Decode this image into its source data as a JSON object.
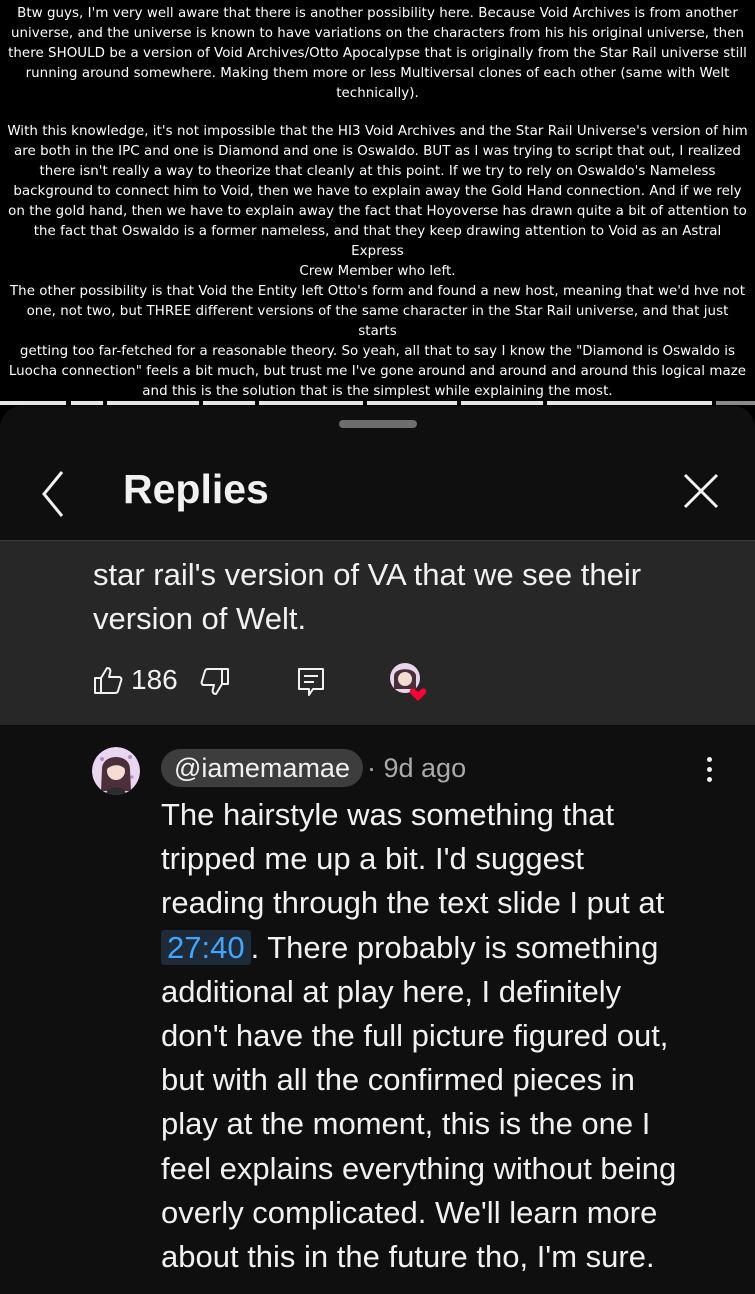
{
  "video_text": {
    "paragraph_1": [
      "Btw guys, I'm very well aware that there is another possibility here. Because Void Archives is from another",
      "universe, and the universe is known to have variations on the characters from his his original universe, then",
      "there SHOULD be a version of Void Archives/Otto Apocalypse that is originally from the Star Rail universe still",
      "running around somewhere. Making them more or less Multiversal clones of each other (same with Welt",
      "technically)."
    ],
    "paragraph_2": [
      "With this knowledge, it's not impossible that the HI3 Void Archives and the Star Rail Universe's version of him",
      "are both in the IPC and one is Diamond and one is Oswaldo. BUT as I was trying to script that out, I realized",
      "there isn't really a way to theorize that cleanly at this point. If we try to rely on Oswaldo's Nameless",
      "background to connect him to Void, then we have to explain away the Gold Hand connection. And if we rely",
      "on the gold hand, then we have to explain away the fact that Hoyoverse has drawn quite a bit of attention to",
      "the fact that Oswaldo is a former nameless, and that they keep drawing attention to Void as an Astral Express",
      "Crew Member who left."
    ],
    "paragraph_3": [
      "The other possibility is that Void the Entity left Otto's form and found a new host, meaning that we'd hve not",
      "one, not two, but THREE different versions of the same character in the Star Rail universe, and that just starts",
      "getting too far-fetched for a reasonable theory. So yeah, all that to say I know the \"Diamond is Oswaldo is",
      "Luocha connection\" feels a bit much, but trust me I've gone around and around and around this logical maze",
      "and this is the solution that is the simplest while explaining the most."
    ]
  },
  "header": {
    "title": "Replies",
    "back_icon": "chevron-left-icon",
    "close_icon": "close-icon"
  },
  "parent_comment": {
    "text_lines": [
      "star rail's version of VA that we see their",
      "version of Welt."
    ],
    "like_count": "186"
  },
  "reply": {
    "author": "@iamemamae",
    "meta": "9d ago",
    "first_line": "The hairstyle was something that",
    "line_2": "tripped me up a bit. I'd suggest",
    "line_3": "reading through the text slide I put at",
    "timestamp": "27:40",
    "line_4_rest": ". There probably is something",
    "line_5": "additional at play here, I definitely",
    "line_6": "don't have the full picture figured out,",
    "line_7": "but with all the confirmed pieces in",
    "line_8": "play at the moment, this is the one I",
    "line_9": "feel explains everything without being",
    "line_10": "overly complicated. We'll learn more",
    "line_11": "about this in the future tho, I'm sure."
  },
  "colors": {
    "background": "#0f0f0f",
    "parent_background": "#272727",
    "author_chip": "#3d3d3d",
    "timestamp_link": "#3ea6ff",
    "heart": "#ff0033"
  }
}
